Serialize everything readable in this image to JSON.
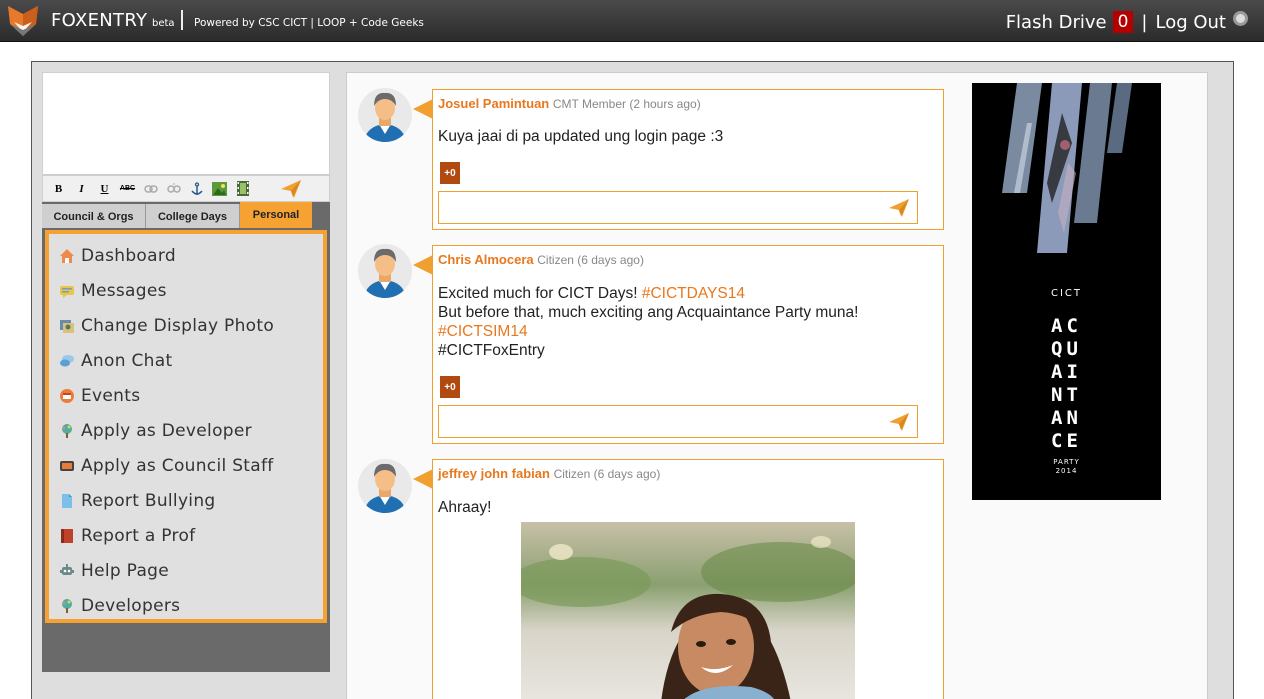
{
  "header": {
    "brand": "FOXENTRY",
    "brand_tag": "beta",
    "powered_by": "Powered by CSC CICT | LOOP + Code Geeks",
    "flash_drive_label": "Flash Drive",
    "flash_drive_count": "0",
    "separator": "|",
    "logout_label": "Log Out"
  },
  "toolbar": {
    "bold": "B",
    "italic": "I",
    "underline": "U",
    "strike": "ABC"
  },
  "tabs": [
    "Council & Orgs",
    "College Days",
    "Personal"
  ],
  "menu": [
    {
      "label": "Dashboard",
      "icon": "home-icon"
    },
    {
      "label": "Messages",
      "icon": "message-icon"
    },
    {
      "label": "Change Display Photo",
      "icon": "photo-icon"
    },
    {
      "label": "Anon Chat",
      "icon": "chat-icon"
    },
    {
      "label": "Events",
      "icon": "events-icon"
    },
    {
      "label": "Apply as Developer",
      "icon": "tree-icon"
    },
    {
      "label": "Apply as Council Staff",
      "icon": "staff-icon"
    },
    {
      "label": "Report Bullying",
      "icon": "document-icon"
    },
    {
      "label": "Report a Prof",
      "icon": "book-icon"
    },
    {
      "label": "Help Page",
      "icon": "robot-icon"
    },
    {
      "label": "Developers",
      "icon": "tree-icon"
    }
  ],
  "posts": [
    {
      "author": "Josuel Pamintuan",
      "meta": "CMT Member (2 hours ago)",
      "body": "Kuya jaai di pa updated ung login page :3",
      "likes": "+0"
    },
    {
      "author": "Chris Almocera",
      "meta": "Citizen (6 days ago)",
      "line1_text": "Excited much for CICT Days! ",
      "line1_tag": "#CICTDAYS14",
      "line2": "But before that, much exciting ang Acquaintance Party muna!",
      "line3_tag": "#CICTSIM14",
      "line4": "#CICTFoxEntry",
      "likes": "+0"
    },
    {
      "author": "jeffrey john fabian",
      "meta": "Citizen (6 days ago)",
      "body": "Ahraay!"
    }
  ],
  "ad": {
    "top": "CICT",
    "big_lines": [
      "AC",
      "QU",
      "AI",
      "NT",
      "AN",
      "CE"
    ],
    "party": "PARTY",
    "year": "2014"
  }
}
